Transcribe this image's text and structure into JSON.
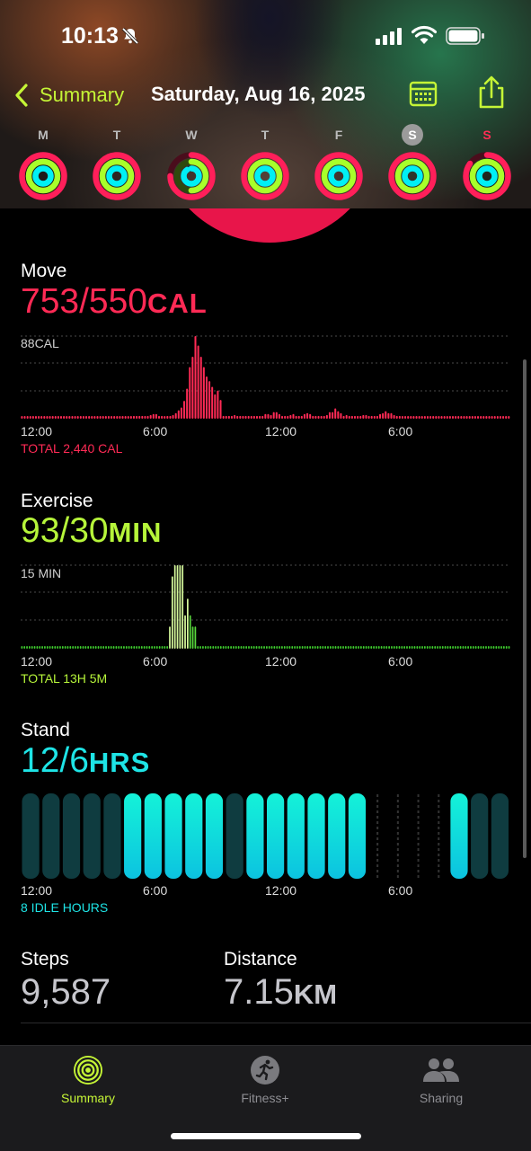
{
  "status": {
    "time": "10:13"
  },
  "nav": {
    "back_label": "Summary",
    "title": "Saturday, Aug 16, 2025"
  },
  "week": [
    {
      "letter": "M",
      "move": 1.37,
      "exercise": 1.0,
      "stand": 1.0
    },
    {
      "letter": "T",
      "move": 1.0,
      "exercise": 1.0,
      "stand": 1.0
    },
    {
      "letter": "W",
      "move": 0.75,
      "exercise": 0.5,
      "stand": 0.9
    },
    {
      "letter": "T",
      "move": 1.0,
      "exercise": 1.0,
      "stand": 1.0
    },
    {
      "letter": "F",
      "move": 1.0,
      "exercise": 1.0,
      "stand": 1.0
    },
    {
      "letter": "S",
      "move": 1.0,
      "exercise": 1.0,
      "stand": 1.0,
      "selected": true
    },
    {
      "letter": "S",
      "move": 0.85,
      "exercise": 1.0,
      "stand": 1.0,
      "today": true
    }
  ],
  "move": {
    "title": "Move",
    "value": "753/550",
    "unit": "CAL",
    "scale_label": "88CAL",
    "total": "TOTAL 2,440 CAL",
    "color": "#ff2a55"
  },
  "exercise": {
    "title": "Exercise",
    "value": "93/30",
    "unit": "MIN",
    "scale_label": "15 MIN",
    "total": "TOTAL 13H 5M",
    "color": "#b6f53a"
  },
  "stand": {
    "title": "Stand",
    "value": "12/6",
    "unit": "HRS",
    "total": "8 IDLE HOURS",
    "color": "#1ee4e6"
  },
  "axis_labels": [
    "12:00",
    "6:00",
    "12:00",
    "6:00"
  ],
  "steps": {
    "label": "Steps",
    "value": "9,587"
  },
  "distance": {
    "label": "Distance",
    "value": "7.15",
    "unit": "KM"
  },
  "tabs": [
    {
      "label": "Summary",
      "active": true
    },
    {
      "label": "Fitness+",
      "active": false
    },
    {
      "label": "Sharing",
      "active": false
    }
  ],
  "chart_data": [
    {
      "type": "bar",
      "title": "Move",
      "x_label_ticks": [
        "12:00",
        "6:00",
        "12:00",
        "6:00"
      ],
      "unit": "CAL",
      "ymax": 88,
      "values": [
        2,
        2,
        2,
        2,
        2,
        2,
        2,
        2,
        2,
        2,
        2,
        2,
        2,
        2,
        2,
        2,
        2,
        2,
        2,
        2,
        2,
        2,
        2,
        2,
        2,
        2,
        2,
        2,
        2,
        2,
        2,
        2,
        2,
        2,
        2,
        2,
        2,
        2,
        2,
        2,
        3,
        3,
        3,
        3,
        3,
        3,
        4,
        5,
        5,
        3,
        3,
        2,
        3,
        3,
        4,
        6,
        9,
        12,
        19,
        32,
        55,
        66,
        88,
        78,
        66,
        55,
        45,
        40,
        34,
        26,
        30,
        20,
        3,
        3,
        3,
        3,
        4,
        3,
        3,
        3,
        3,
        3,
        3,
        3,
        3,
        3,
        3,
        5,
        5,
        4,
        7,
        7,
        5,
        3,
        3,
        3,
        4,
        5,
        3,
        3,
        3,
        5,
        6,
        5,
        3,
        3,
        3,
        3,
        3,
        4,
        7,
        7,
        11,
        8,
        6,
        3,
        4,
        3,
        3,
        3,
        3,
        3,
        4,
        4,
        3,
        3,
        3,
        3,
        5,
        6,
        8,
        6,
        6,
        4,
        3,
        3,
        2,
        2,
        2,
        2,
        2,
        2,
        2,
        2,
        2,
        2,
        2,
        2,
        2,
        2,
        2,
        2,
        2,
        2,
        2,
        2,
        2,
        2,
        2,
        2,
        2,
        2,
        2,
        2,
        2,
        2,
        2,
        2,
        2,
        2,
        2,
        2,
        2,
        2,
        2
      ]
    },
    {
      "type": "bar",
      "title": "Exercise",
      "x_label_ticks": [
        "12:00",
        "6:00",
        "12:00",
        "6:00"
      ],
      "unit": "MIN",
      "ymax": 15,
      "values_by_minute_bucket": [
        0,
        0,
        0,
        0,
        0,
        0,
        0,
        0,
        0,
        0,
        0,
        0,
        0,
        0,
        0,
        0,
        0,
        0,
        0,
        0,
        0,
        0,
        0,
        0,
        0,
        0,
        0,
        0,
        0,
        0,
        0,
        0,
        0,
        0,
        0,
        0,
        0,
        0,
        0,
        0,
        0,
        0,
        0,
        0,
        0,
        0,
        0,
        0,
        0,
        0,
        0,
        0,
        0,
        0,
        0,
        0,
        0,
        0,
        4,
        13,
        15,
        15,
        15,
        15,
        6,
        9,
        6,
        4,
        4,
        0,
        0,
        0,
        0,
        0,
        0,
        0,
        0,
        0,
        0,
        0,
        0,
        0,
        0,
        0,
        0,
        0,
        0,
        0,
        0,
        0,
        0,
        0,
        0,
        0,
        0,
        0,
        0,
        0,
        0,
        0,
        0,
        0,
        0,
        0,
        0,
        0,
        0,
        0,
        0,
        0,
        0,
        0,
        0,
        0,
        0,
        0,
        0,
        0,
        0,
        0,
        0,
        0,
        0,
        0,
        0,
        0,
        0,
        0,
        0,
        0,
        0,
        0,
        0,
        0,
        0,
        0,
        0,
        0,
        0,
        0,
        0,
        0,
        0,
        0,
        0,
        0,
        0,
        0,
        0,
        0,
        0,
        0,
        0,
        0,
        0,
        0,
        0,
        0,
        0,
        0,
        0,
        0,
        0,
        0,
        0,
        0,
        0,
        0,
        0,
        0,
        0,
        0,
        0,
        0,
        0,
        0,
        0,
        0,
        0,
        0,
        0,
        0,
        0,
        0,
        0,
        0,
        0,
        0,
        0,
        0,
        0,
        0
      ],
      "low_bars_from_index": [
        66,
        67,
        68,
        69,
        70
      ]
    },
    {
      "type": "bar",
      "title": "Stand",
      "x_label_ticks": [
        "12:00",
        "6:00",
        "12:00",
        "6:00"
      ],
      "hours": [
        0,
        0,
        0,
        0,
        0,
        1,
        1,
        1,
        1,
        1,
        0,
        1,
        1,
        1,
        1,
        1,
        1,
        -1,
        -1,
        -1,
        -1,
        1,
        0,
        0
      ],
      "legend": "1 = stood, 0 = idle, -1 = no data"
    }
  ]
}
